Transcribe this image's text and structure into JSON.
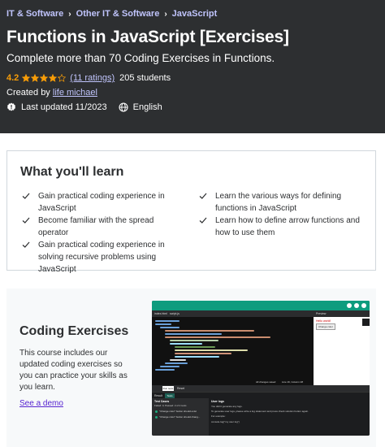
{
  "breadcrumbs": [
    "IT & Software",
    "Other IT & Software",
    "JavaScript"
  ],
  "course": {
    "title": "Functions in JavaScript [Exercises]",
    "subtitle": "Complete more than 70 Coding Exercises in Functions.",
    "rating": "4.2",
    "stars": 4.2,
    "ratings_count": "(11 ratings)",
    "students": "205 students",
    "created_by_label": "Created by",
    "instructor": "life michael",
    "last_updated": "Last updated 11/2023",
    "language": "English"
  },
  "learn": {
    "title": "What you'll learn",
    "items": [
      "Gain practical coding experience in JavaScript",
      "Learn the various ways for defining functions in JavaScript",
      "Become familiar with the spread operator",
      "Learn how to define arrow functions and how to use them",
      "Gain practical coding experience in solving recursive problems using JavaScript"
    ]
  },
  "coding_exercises": {
    "title": "Coding Exercises",
    "description": "This course includes our updated coding exercises so you can practice your skills as you learn.",
    "demo_link": "See a demo",
    "screenshot": {
      "tab_files": [
        "index.html",
        "script.js"
      ],
      "preview_label": "Preview",
      "preview_text": "Hello world!",
      "preview_button": "Change color",
      "run_button": "Run tests",
      "reset_button": "Reset",
      "results_tab": "Result",
      "results_badge": "Tests",
      "status_left": "All changes saved",
      "status_right": "Line 16, Column 28",
      "test_cases_title": "Test Cases",
      "test_summary": "Failed: 0, Passed: 2 of 2 tests",
      "tests": [
        "\"Change color\" button should exist",
        "\"Change color\" button should chang..."
      ],
      "user_logs_title": "User logs",
      "user_log_lines": [
        "You didn't generate any logs.",
        "To generate user logs, please write a log statement and press check solution button again.",
        "For example:",
        "console.log(\"my user log\")"
      ]
    }
  },
  "colors": {
    "hero_bg": "#2d2f31",
    "link_light": "#c0c4fc",
    "star": "#f69c08",
    "demo_link": "#5624d0",
    "accent_green": "#0e9c7e"
  },
  "icons": {
    "breadcrumb_separator": "chevron-right-icon",
    "star": "star-icon",
    "updated": "alert-badge-icon",
    "language": "globe-icon",
    "learn_bullet": "check-icon"
  }
}
